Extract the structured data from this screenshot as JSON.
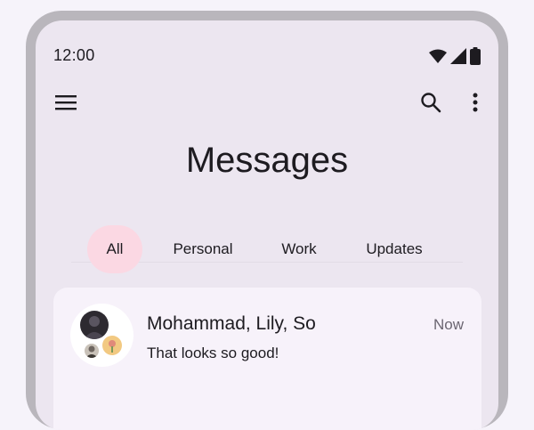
{
  "status_bar": {
    "time": "12:00",
    "icons": [
      "wifi-icon",
      "signal-icon",
      "battery-icon"
    ]
  },
  "top_bar": {
    "icons": [
      "menu-icon",
      "search-icon",
      "more-vert-icon"
    ]
  },
  "page": {
    "title": "Messages"
  },
  "tabs": [
    {
      "label": "All",
      "active": true
    },
    {
      "label": "Personal",
      "active": false
    },
    {
      "label": "Work",
      "active": false
    },
    {
      "label": "Updates",
      "active": false
    }
  ],
  "conversations": [
    {
      "names": "Mohammad, Lily, So",
      "time": "Now",
      "preview": "That looks so good!"
    }
  ],
  "colors": {
    "screen_background": "#ece6f0",
    "frame": "#b9b6bc",
    "active_tab": "#fbd8e3",
    "card": "#f7f2fa",
    "text_primary": "#1d1b20"
  }
}
